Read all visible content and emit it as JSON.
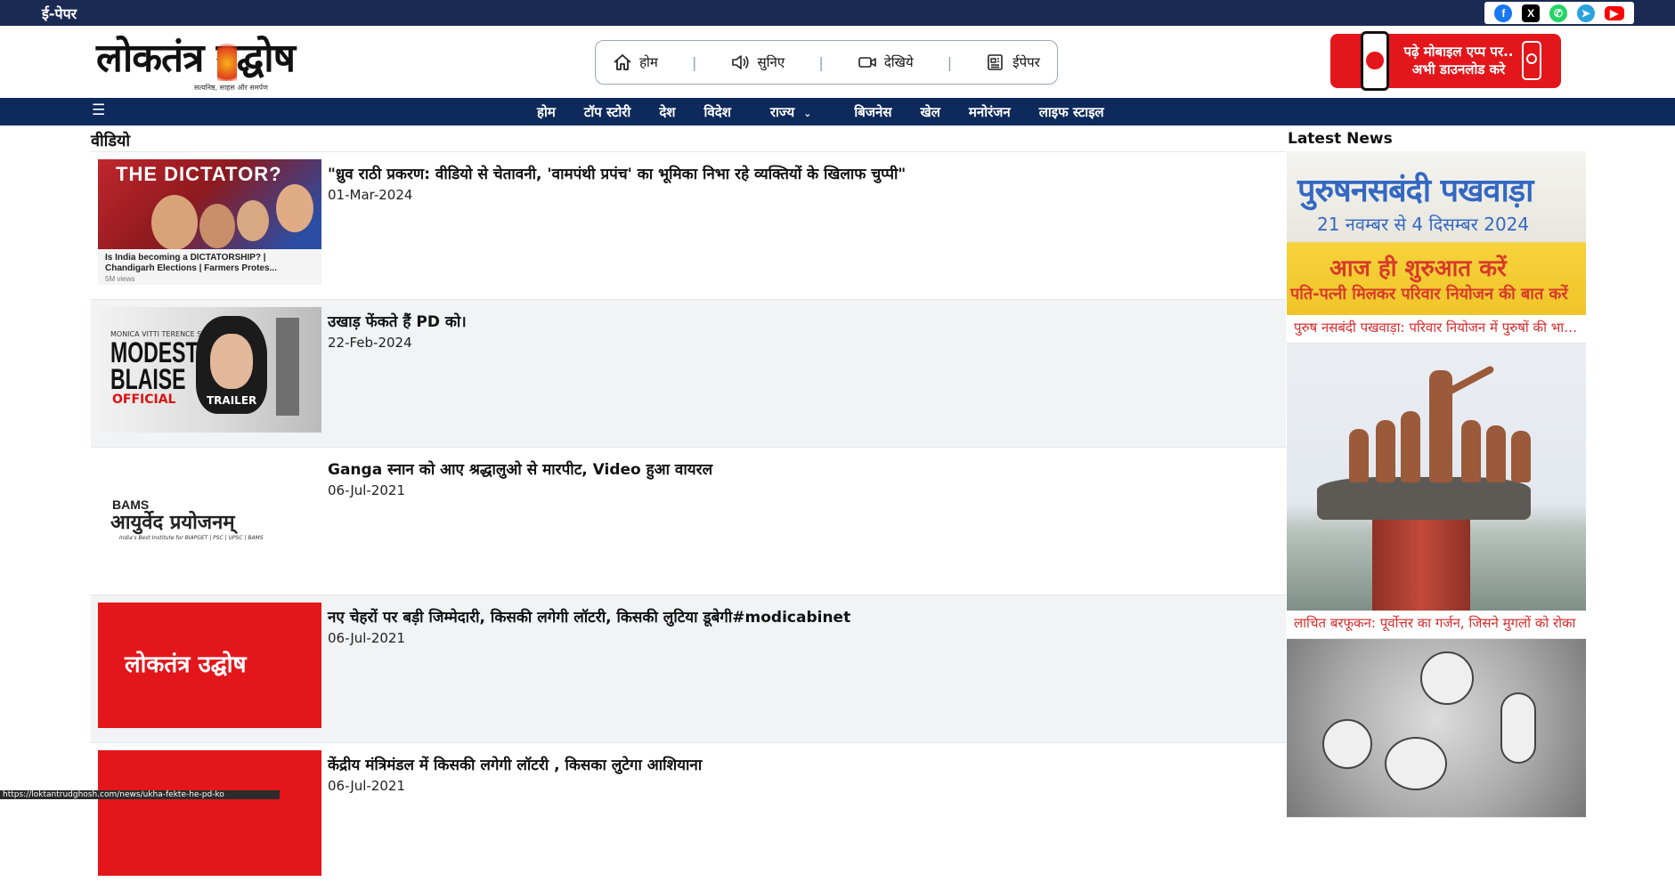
{
  "topbar": {
    "epaper_label": "ई-पेपर",
    "social": [
      {
        "name": "facebook-icon",
        "glyph": "f"
      },
      {
        "name": "x-icon",
        "glyph": "X"
      },
      {
        "name": "whatsapp-icon",
        "glyph": "✆"
      },
      {
        "name": "telegram-icon",
        "glyph": "➤"
      },
      {
        "name": "youtube-icon",
        "glyph": "▶"
      }
    ]
  },
  "header": {
    "logo_text": "लोकतंत्र उद्घोष",
    "logo_tagline": "सत्यनिष्ठ, साहस और समर्पण",
    "quicknav": [
      {
        "label": "होम",
        "icon": "home-icon"
      },
      {
        "label": "सुनिए",
        "icon": "speaker-icon"
      },
      {
        "label": "देखिये",
        "icon": "video-icon"
      },
      {
        "label": "ईपेपर",
        "icon": "newspaper-icon"
      }
    ],
    "app_banner": {
      "line1": "पढ़े मोबाइल एप्प पर..",
      "line2": "अभी डाउनलोड करे"
    }
  },
  "mainnav": {
    "menu_icon": "☰",
    "items": [
      "होम",
      "टॉप स्टोरी",
      "देश",
      "विदेश",
      "राज्य",
      "बिजनेस",
      "खेल",
      "मनोरंजन",
      "लाइफ स्टाइल"
    ],
    "dropdown_caret": "⌄"
  },
  "section": {
    "title": "वीडियो",
    "videos": [
      {
        "title": "\"ध्रुव राठी प्रकरण: वीडियो से चेतावनी, 'वामपंथी प्रपंच' का भूमिका निभा रहे व्यक्तियों के खिलाफ चुप्पी\"",
        "date": "01-Mar-2024",
        "thumb": {
          "headline": "THE DICTATOR?",
          "caption": "Is India becoming a DICTATORSHIP? | Chandigarh Elections | Farmers Protes...",
          "views": "5M views"
        }
      },
      {
        "title": "उखाड़ फेंकते हैं PD को।",
        "date": "22-Feb-2024",
        "thumb": {
          "names": "MONICA VITTI   TERENCE STAMP",
          "headline": "MODESTY BLAISE",
          "tag1": "OFFICIAL",
          "tag2": "TRAILER"
        }
      },
      {
        "title": "Ganga स्नान को आए श्रद्धालुओ से मारपीट, Video हुआ वायरल",
        "date": "06-Jul-2021",
        "thumb": {
          "brand": "BAMS",
          "headline": "आयुर्वेद प्रयोजनम्",
          "tagline": "India's Best Institute for BIAPGET | PSC | UPSC | BAMS"
        }
      },
      {
        "title": "नए चेहरों पर बड़ी जिम्मेदारी, किसकी लगेगी लॉटरी, किसकी लुटिया डूबेगी#modicabinet",
        "date": "06-Jul-2021",
        "thumb": {
          "headline": "लोकतंत्र उद्घोष"
        }
      },
      {
        "title": "केंद्रीय मंत्रिमंडल में किसकी लगेगी लॉटरी , किसका लुटेगा आशियाना",
        "date": "06-Jul-2021",
        "thumb": {
          "headline": ""
        }
      }
    ]
  },
  "latest_news": {
    "title": "Latest News",
    "items": [
      {
        "caption": "पुरुष नसबंदी पखवाड़ा: परिवार नियोजन में पुरुषों की भागीदारी",
        "image_text": {
          "l1": "पुरुषनसबंदी पखवाड़ा",
          "l2": "21 नवम्बर से 4 दिसम्बर 2024",
          "l3": "आज ही शुरुआत करें",
          "l4": "पति-पत्नी मिलकर परिवार नियोजन की बात करें"
        }
      },
      {
        "caption": "लाचित बरफूकन: पूर्वोत्तर का गर्जन, जिसने मुगलों को रोका"
      },
      {
        "caption": ""
      }
    ]
  },
  "status_url": "https://loktantrudghosh.com/news/ukha-fekte-he-pd-ko",
  "colors": {
    "topbar": "#1b2a52",
    "mainnav": "#0e2a5c",
    "accent_red": "#e3161b",
    "caption_red": "#d72b2b"
  }
}
